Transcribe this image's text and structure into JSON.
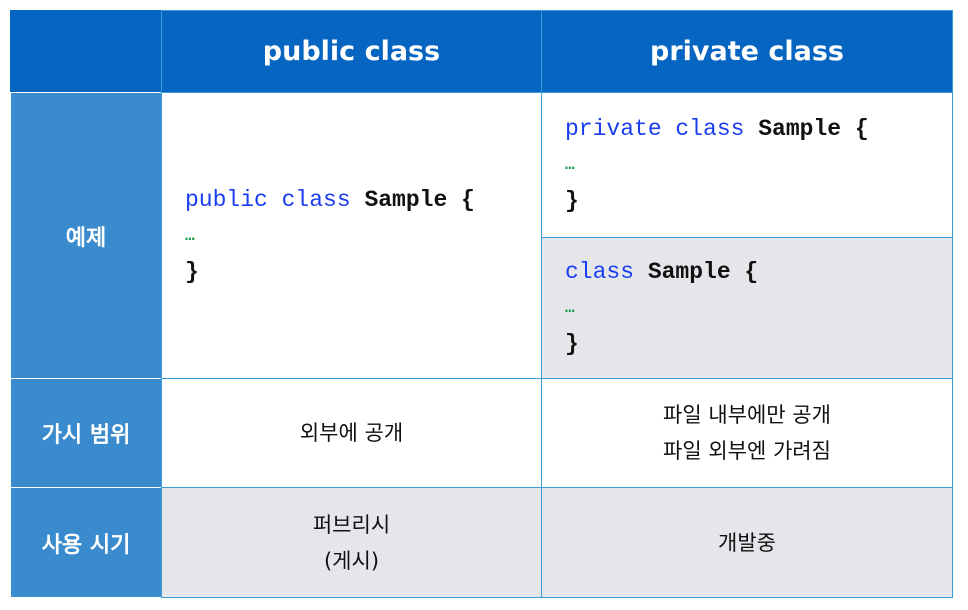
{
  "header": {
    "col1": "public class",
    "col2": "private class"
  },
  "rows": {
    "example": {
      "label": "예제",
      "public": {
        "kw": "public class",
        "rest": " Sample {",
        "ellipsis": "…",
        "close": "}"
      },
      "private": {
        "kw": "private class",
        "rest": " Sample {",
        "ellipsis": "…",
        "close": "}"
      },
      "default": {
        "kw": "class",
        "rest": " Sample {",
        "ellipsis": "…",
        "close": "}"
      }
    },
    "visibility": {
      "label": "가시 범위",
      "public": "외부에 공개",
      "private_line1": "파일 내부에만 공개",
      "private_line2": "파일 외부엔 가려짐"
    },
    "usage": {
      "label": "사용 시기",
      "public_line1": "퍼브리시",
      "public_line2": "(게시)",
      "private": "개발중"
    }
  },
  "colors": {
    "header": "#0565c0",
    "row_header": "#3a8bcd",
    "keyword": "#1a3df0",
    "ellipsis": "#149a4a",
    "shaded": "#e4e6ea"
  }
}
